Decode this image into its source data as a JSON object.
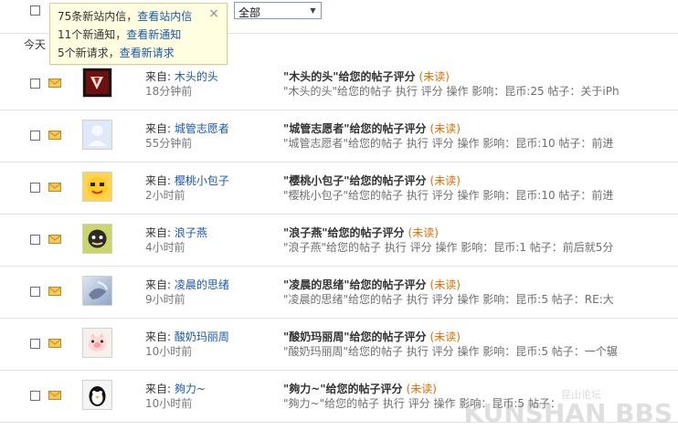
{
  "filter": {
    "selected": "全部"
  },
  "popup": {
    "close_glyph": "×",
    "lines": [
      {
        "prefix": "75条新站内信，",
        "link": "查看站内信"
      },
      {
        "prefix": "11个新通知，",
        "link": "查看新通知"
      },
      {
        "prefix": "5个新请求，",
        "link": "查看新请求"
      }
    ]
  },
  "list": {
    "group_label": "今天",
    "from_label": "来自:",
    "unread_label": "(未读)",
    "items": [
      {
        "sender": "木头的头",
        "time": "18分钟前",
        "subject": "\"木头的头\"给您的帖子评分",
        "snippet": "\"木头的头\"给您的帖子 执行 评分 操作 影响：昆币:25 帖子：关于iPh",
        "avatar": "avatar-dark-red"
      },
      {
        "sender": "城管志愿者",
        "time": "55分钟前",
        "subject": "\"城管志愿者\"给您的帖子评分",
        "snippet": "\"城管志愿者\"给您的帖子 执行 评分 操作 影响：昆币:10 帖子：前进",
        "avatar": "avatar-default-blue"
      },
      {
        "sender": "樱桃小包子",
        "time": "2小时前",
        "subject": "\"樱桃小包子\"给您的帖子评分",
        "snippet": "\"樱桃小包子\"给您的帖子 执行 评分 操作 影响：昆币:10 帖子：前进",
        "avatar": "avatar-yellow-face"
      },
      {
        "sender": "浪子燕",
        "time": "4小时前",
        "subject": "\"浪子燕\"给您的帖子评分",
        "snippet": "\"浪子燕\"给您的帖子 执行 评分 操作 影响：昆币:1 帖子：前后就5分",
        "avatar": "avatar-round-face"
      },
      {
        "sender": "凌晨的思绪",
        "time": "9小时前",
        "subject": "\"凌晨的思绪\"给您的帖子评分",
        "snippet": "\"凌晨的思绪\"给您的帖子 执行 评分 操作 影响：昆币:5 帖子：RE:大",
        "avatar": "avatar-bluish-photo"
      },
      {
        "sender": "酸奶玛丽周",
        "time": "10小时前",
        "subject": "\"酸奶玛丽周\"给您的帖子评分",
        "snippet": "\"酸奶玛丽周\"给您的帖子 执行 评分 操作 影响：昆币:5 帖子：一个辗",
        "avatar": "avatar-pig"
      },
      {
        "sender": "夠力~",
        "time": "10小时前",
        "subject": "\"夠力~\"给您的帖子评分",
        "snippet": "\"夠力~\"给您的帖子 执行 评分 操作 影响：昆币:5 帖子：",
        "avatar": "avatar-penguin"
      }
    ]
  },
  "watermark": {
    "main": "KUNSHAN BBS",
    "sub": "昆山论坛"
  },
  "icons": {
    "envelope": "envelope-icon",
    "close": "close-icon",
    "dropdown": "chevron-down-icon"
  }
}
